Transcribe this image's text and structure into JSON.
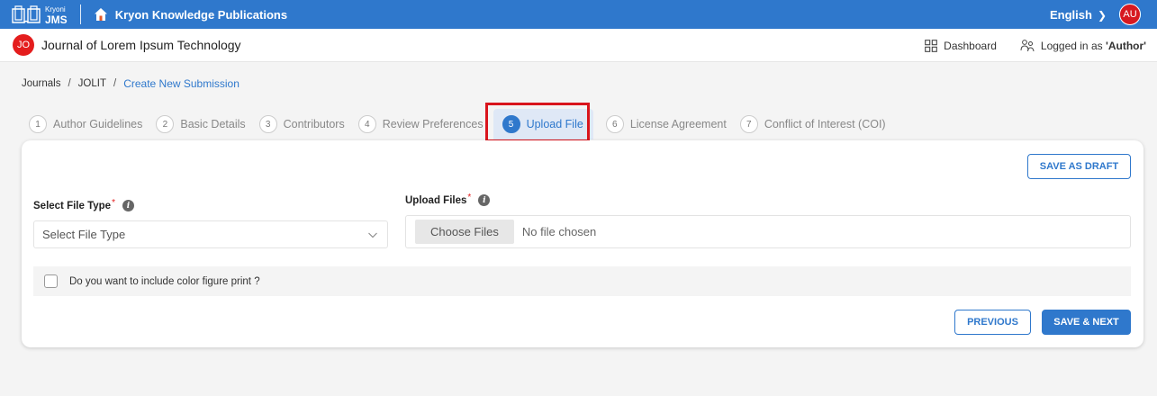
{
  "topbar": {
    "logo_small": "Kryoni",
    "logo_big": "JMS",
    "brand_title": "Kryon Knowledge Publications",
    "language": "English",
    "user_initials": "AU",
    "accent_color": "#2f78cc"
  },
  "journal": {
    "initials": "JO",
    "title": "Journal of Lorem Ipsum Technology",
    "dashboard_label": "Dashboard",
    "logged_in_prefix": "Logged in as ",
    "logged_in_role": "'Author'"
  },
  "breadcrumb": {
    "items": [
      "Journals",
      "JOLIT",
      "Create New Submission"
    ],
    "separator": "/"
  },
  "steps": [
    {
      "num": "1",
      "label": "Author Guidelines"
    },
    {
      "num": "2",
      "label": "Basic Details"
    },
    {
      "num": "3",
      "label": "Contributors"
    },
    {
      "num": "4",
      "label": "Review Preferences"
    },
    {
      "num": "5",
      "label": "Upload File",
      "active": true
    },
    {
      "num": "6",
      "label": "License Agreement"
    },
    {
      "num": "7",
      "label": "Conflict of Interest (COI)"
    }
  ],
  "form": {
    "save_draft": "SAVE AS DRAFT",
    "file_type_label": "Select File Type",
    "file_type_placeholder": "Select File Type",
    "upload_label": "Upload Files",
    "required_mark": "*",
    "info_glyph": "i",
    "choose_files": "Choose Files",
    "no_file": "No file chosen",
    "color_print_question": "Do you want to include color figure print ?",
    "previous": "PREVIOUS",
    "save_next": "SAVE & NEXT"
  }
}
